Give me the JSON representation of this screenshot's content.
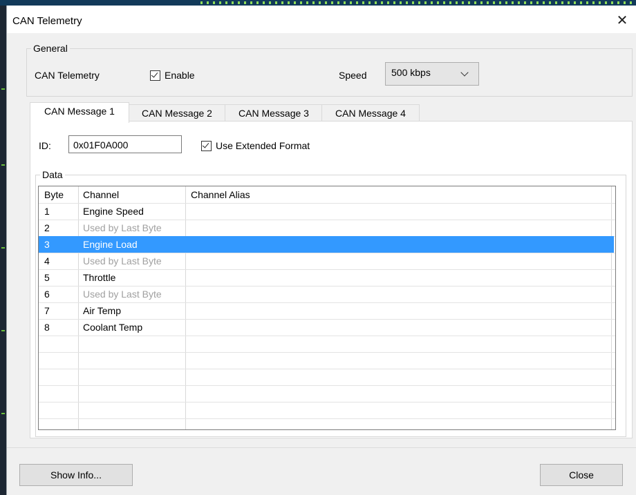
{
  "window": {
    "title": "CAN Telemetry",
    "close_glyph": "✕"
  },
  "general": {
    "legend": "General",
    "can_telemetry_label": "CAN Telemetry",
    "enable_label": "Enable",
    "enable_checked": true,
    "speed_label": "Speed",
    "speed_value": "500 kbps"
  },
  "tabs": [
    "CAN Message 1",
    "CAN Message 2",
    "CAN Message 3",
    "CAN Message 4"
  ],
  "message": {
    "id_label": "ID:",
    "id_value": "0x01F0A000",
    "extended_label": "Use Extended Format",
    "extended_checked": true
  },
  "data": {
    "legend": "Data",
    "columns": [
      "Byte",
      "Channel",
      "Channel Alias"
    ],
    "rows": [
      {
        "byte": "1",
        "channel": "Engine Speed",
        "alias": "",
        "muted": false,
        "selected": false
      },
      {
        "byte": "2",
        "channel": "Used by Last Byte",
        "alias": "",
        "muted": true,
        "selected": false
      },
      {
        "byte": "3",
        "channel": "Engine Load",
        "alias": "",
        "muted": false,
        "selected": true
      },
      {
        "byte": "4",
        "channel": "Used by Last Byte",
        "alias": "",
        "muted": true,
        "selected": false
      },
      {
        "byte": "5",
        "channel": "Throttle",
        "alias": "",
        "muted": false,
        "selected": false
      },
      {
        "byte": "6",
        "channel": "Used by Last Byte",
        "alias": "",
        "muted": true,
        "selected": false
      },
      {
        "byte": "7",
        "channel": "Air Temp",
        "alias": "",
        "muted": false,
        "selected": false
      },
      {
        "byte": "8",
        "channel": "Coolant Temp",
        "alias": "",
        "muted": false,
        "selected": false
      }
    ]
  },
  "buttons": {
    "show_info": "Show Info...",
    "close": "Close"
  },
  "colors": {
    "selection": "#3399ff",
    "muted_text": "#a0a0a0",
    "window_bg": "#f0f0f0"
  }
}
